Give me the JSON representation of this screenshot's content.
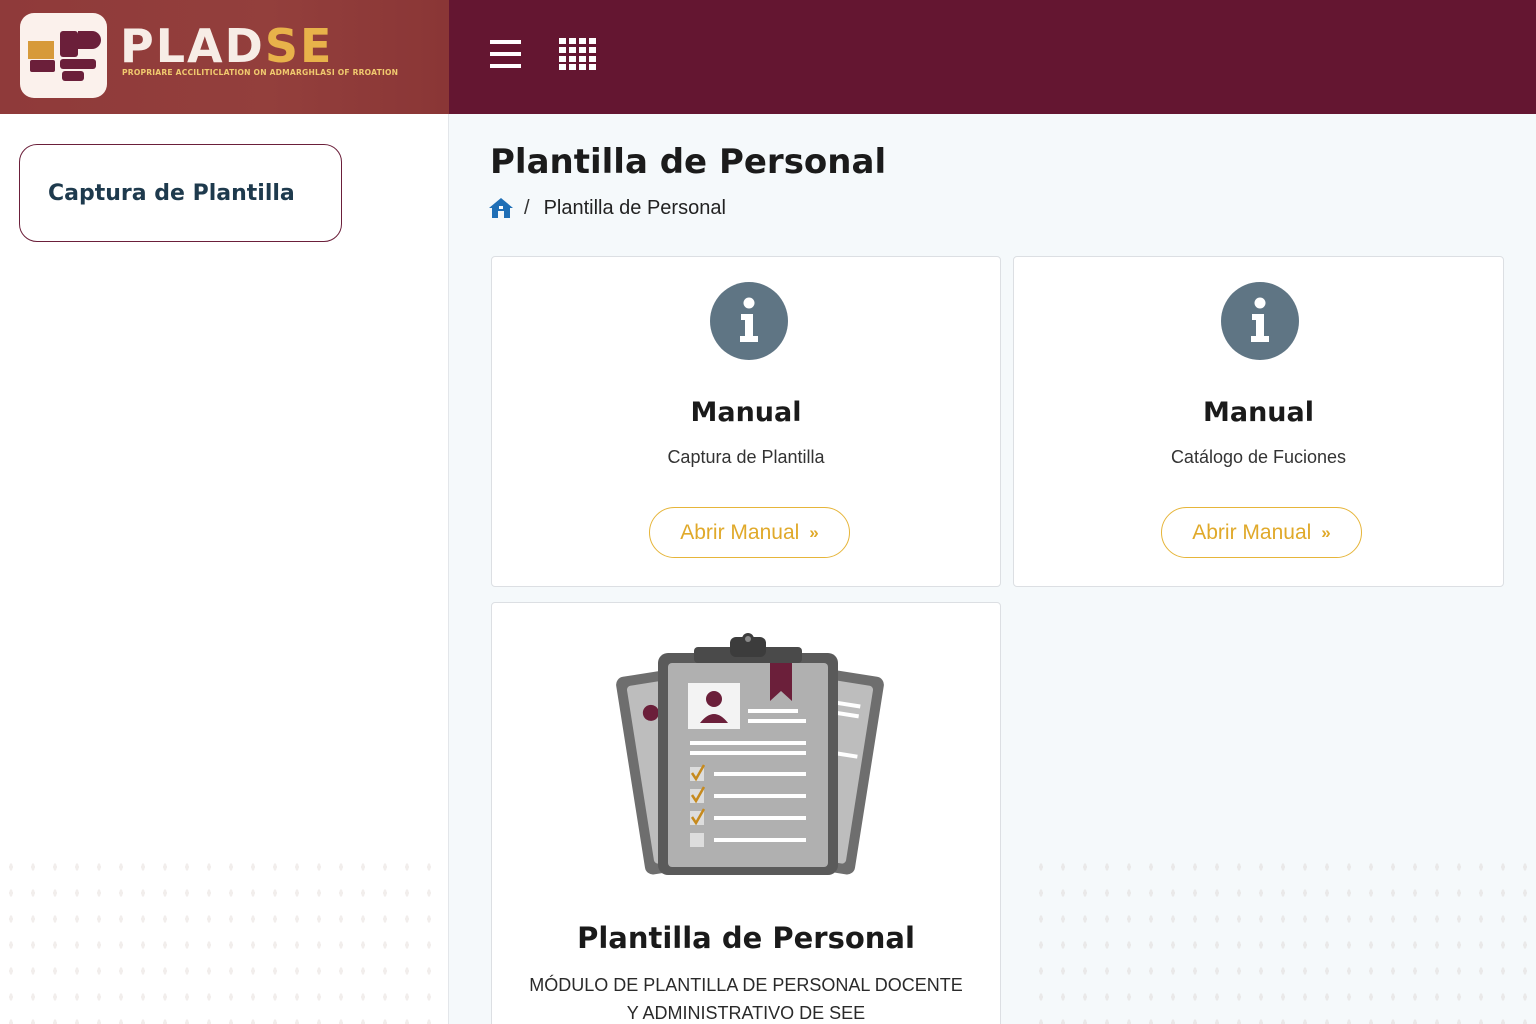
{
  "brand": {
    "name_part1": "PLAD",
    "name_part2": "SE",
    "tagline": "PROPRIARE ACCILITICLATION ON ADMARGHLASI OF RROATION"
  },
  "topbar": {
    "menu_icon": "hamburger-icon",
    "apps_icon": "grid-apps-icon"
  },
  "sidebar": {
    "items": [
      {
        "label": "Captura de Plantilla"
      }
    ]
  },
  "page": {
    "title": "Plantilla de Personal",
    "breadcrumb": {
      "home_icon": "home-icon",
      "separator": "/",
      "current": "Plantilla de Personal"
    }
  },
  "cards": [
    {
      "icon": "info-icon",
      "title": "Manual",
      "subtitle": "Captura de Plantilla",
      "button_label": "Abrir Manual",
      "button_icon": "»"
    },
    {
      "icon": "info-icon",
      "title": "Manual",
      "subtitle": "Catálogo de Fuciones",
      "button_label": "Abrir Manual",
      "button_icon": "»"
    },
    {
      "icon": "clipboard-documents-illustration",
      "title": "Plantilla de Personal",
      "description": "MÓDULO DE PLANTILLA DE PERSONAL DOCENTE Y ADMINISTRATIVO DE SEE"
    }
  ],
  "colors": {
    "brand_bg": "#933f3c",
    "topbar_bg": "#641631",
    "accent_gold": "#e6b53a",
    "info_icon": "#5f7584",
    "sidebar_border": "#6b1f3a"
  }
}
